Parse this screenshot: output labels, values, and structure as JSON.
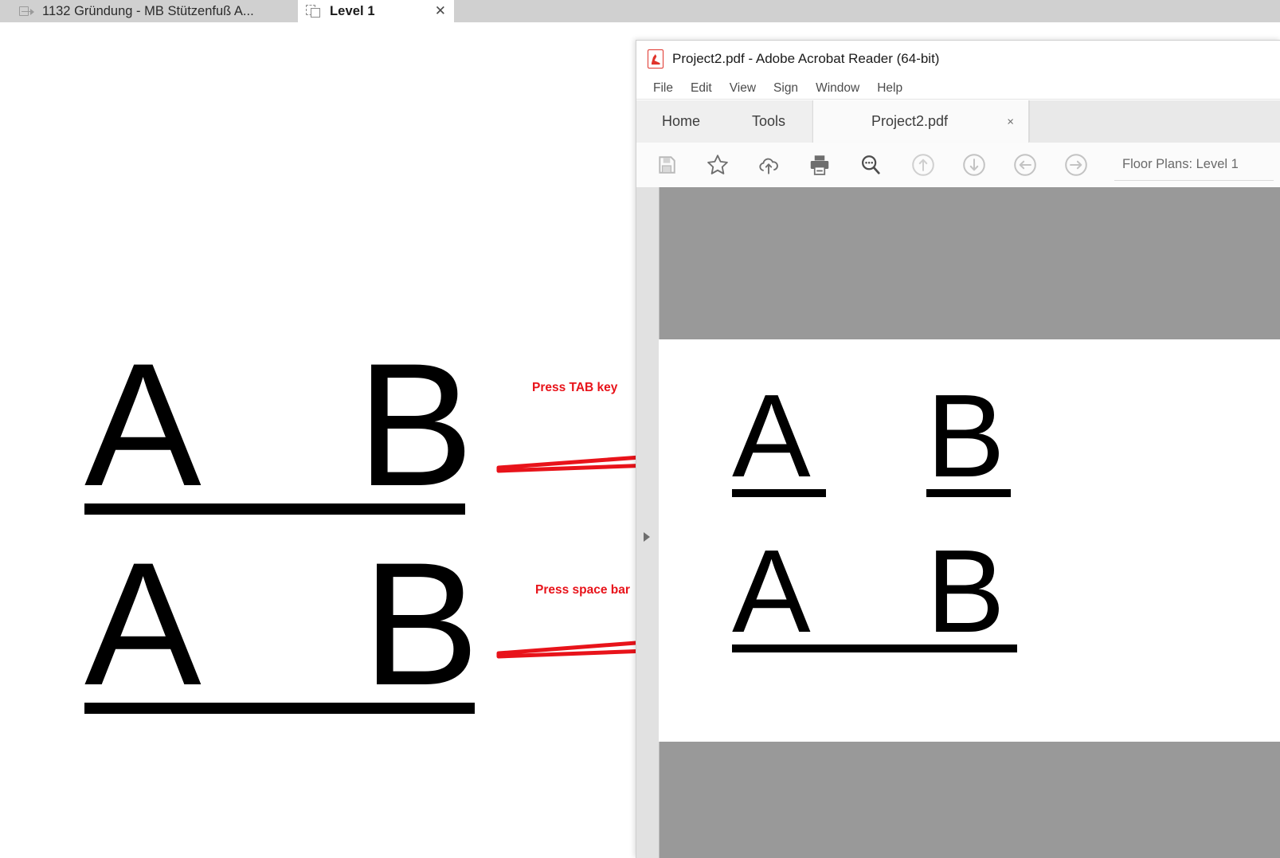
{
  "host_app": {
    "tabs": [
      {
        "label": "1132 Gründung - MB Stützenfuß A...",
        "icon": "export-sheet-icon",
        "active": false
      },
      {
        "label": "Level 1",
        "icon": "sheets-icon",
        "active": true,
        "close": "✕"
      }
    ]
  },
  "cad_drawing": {
    "rows": [
      {
        "letters": [
          "A",
          "B"
        ],
        "underline": "continuous"
      },
      {
        "letters": [
          "A",
          "B"
        ],
        "underline": "continuous"
      }
    ],
    "letter_a": "A",
    "letter_b": "B"
  },
  "annotations": {
    "color": "#e8131a",
    "items": [
      {
        "label": "Press TAB key"
      },
      {
        "label": "Press space bar"
      }
    ]
  },
  "acrobat": {
    "title": "Project2.pdf - Adobe Acrobat Reader (64-bit)",
    "title_icon": "pdf-file-icon",
    "menu": [
      "File",
      "Edit",
      "View",
      "Sign",
      "Window",
      "Help"
    ],
    "tabs": {
      "home": "Home",
      "tools": "Tools",
      "document": "Project2.pdf",
      "document_close": "×"
    },
    "toolbar": {
      "buttons": [
        {
          "name": "save-icon",
          "title": "Save"
        },
        {
          "name": "star-icon",
          "title": "Add to favorites"
        },
        {
          "name": "cloud-upload-icon",
          "title": "Upload to cloud"
        },
        {
          "name": "print-icon",
          "title": "Print"
        },
        {
          "name": "search-comment-icon",
          "title": "Search"
        },
        {
          "name": "arrow-up-circle-icon",
          "title": "Previous page"
        },
        {
          "name": "arrow-down-circle-icon",
          "title": "Next page"
        },
        {
          "name": "arrow-left-circle-icon",
          "title": "Previous view"
        },
        {
          "name": "arrow-right-circle-icon",
          "title": "Next view"
        }
      ],
      "page_label": "Floor Plans: Level 1"
    },
    "page_content": {
      "rows": [
        {
          "letters": [
            "A",
            "B"
          ],
          "underline": "separate"
        },
        {
          "letters": [
            "A",
            "B"
          ],
          "underline": "continuous"
        }
      ],
      "letter_a": "A",
      "letter_b": "B"
    },
    "nav_panel": {
      "expand_icon": "chevron-right-icon"
    }
  },
  "colors": {
    "annotation_red": "#e8131a",
    "pdf_backdrop_gray": "#999999",
    "nav_panel_gray": "#e1e1e1",
    "tabstrip_gray": "#d0d0d0"
  }
}
